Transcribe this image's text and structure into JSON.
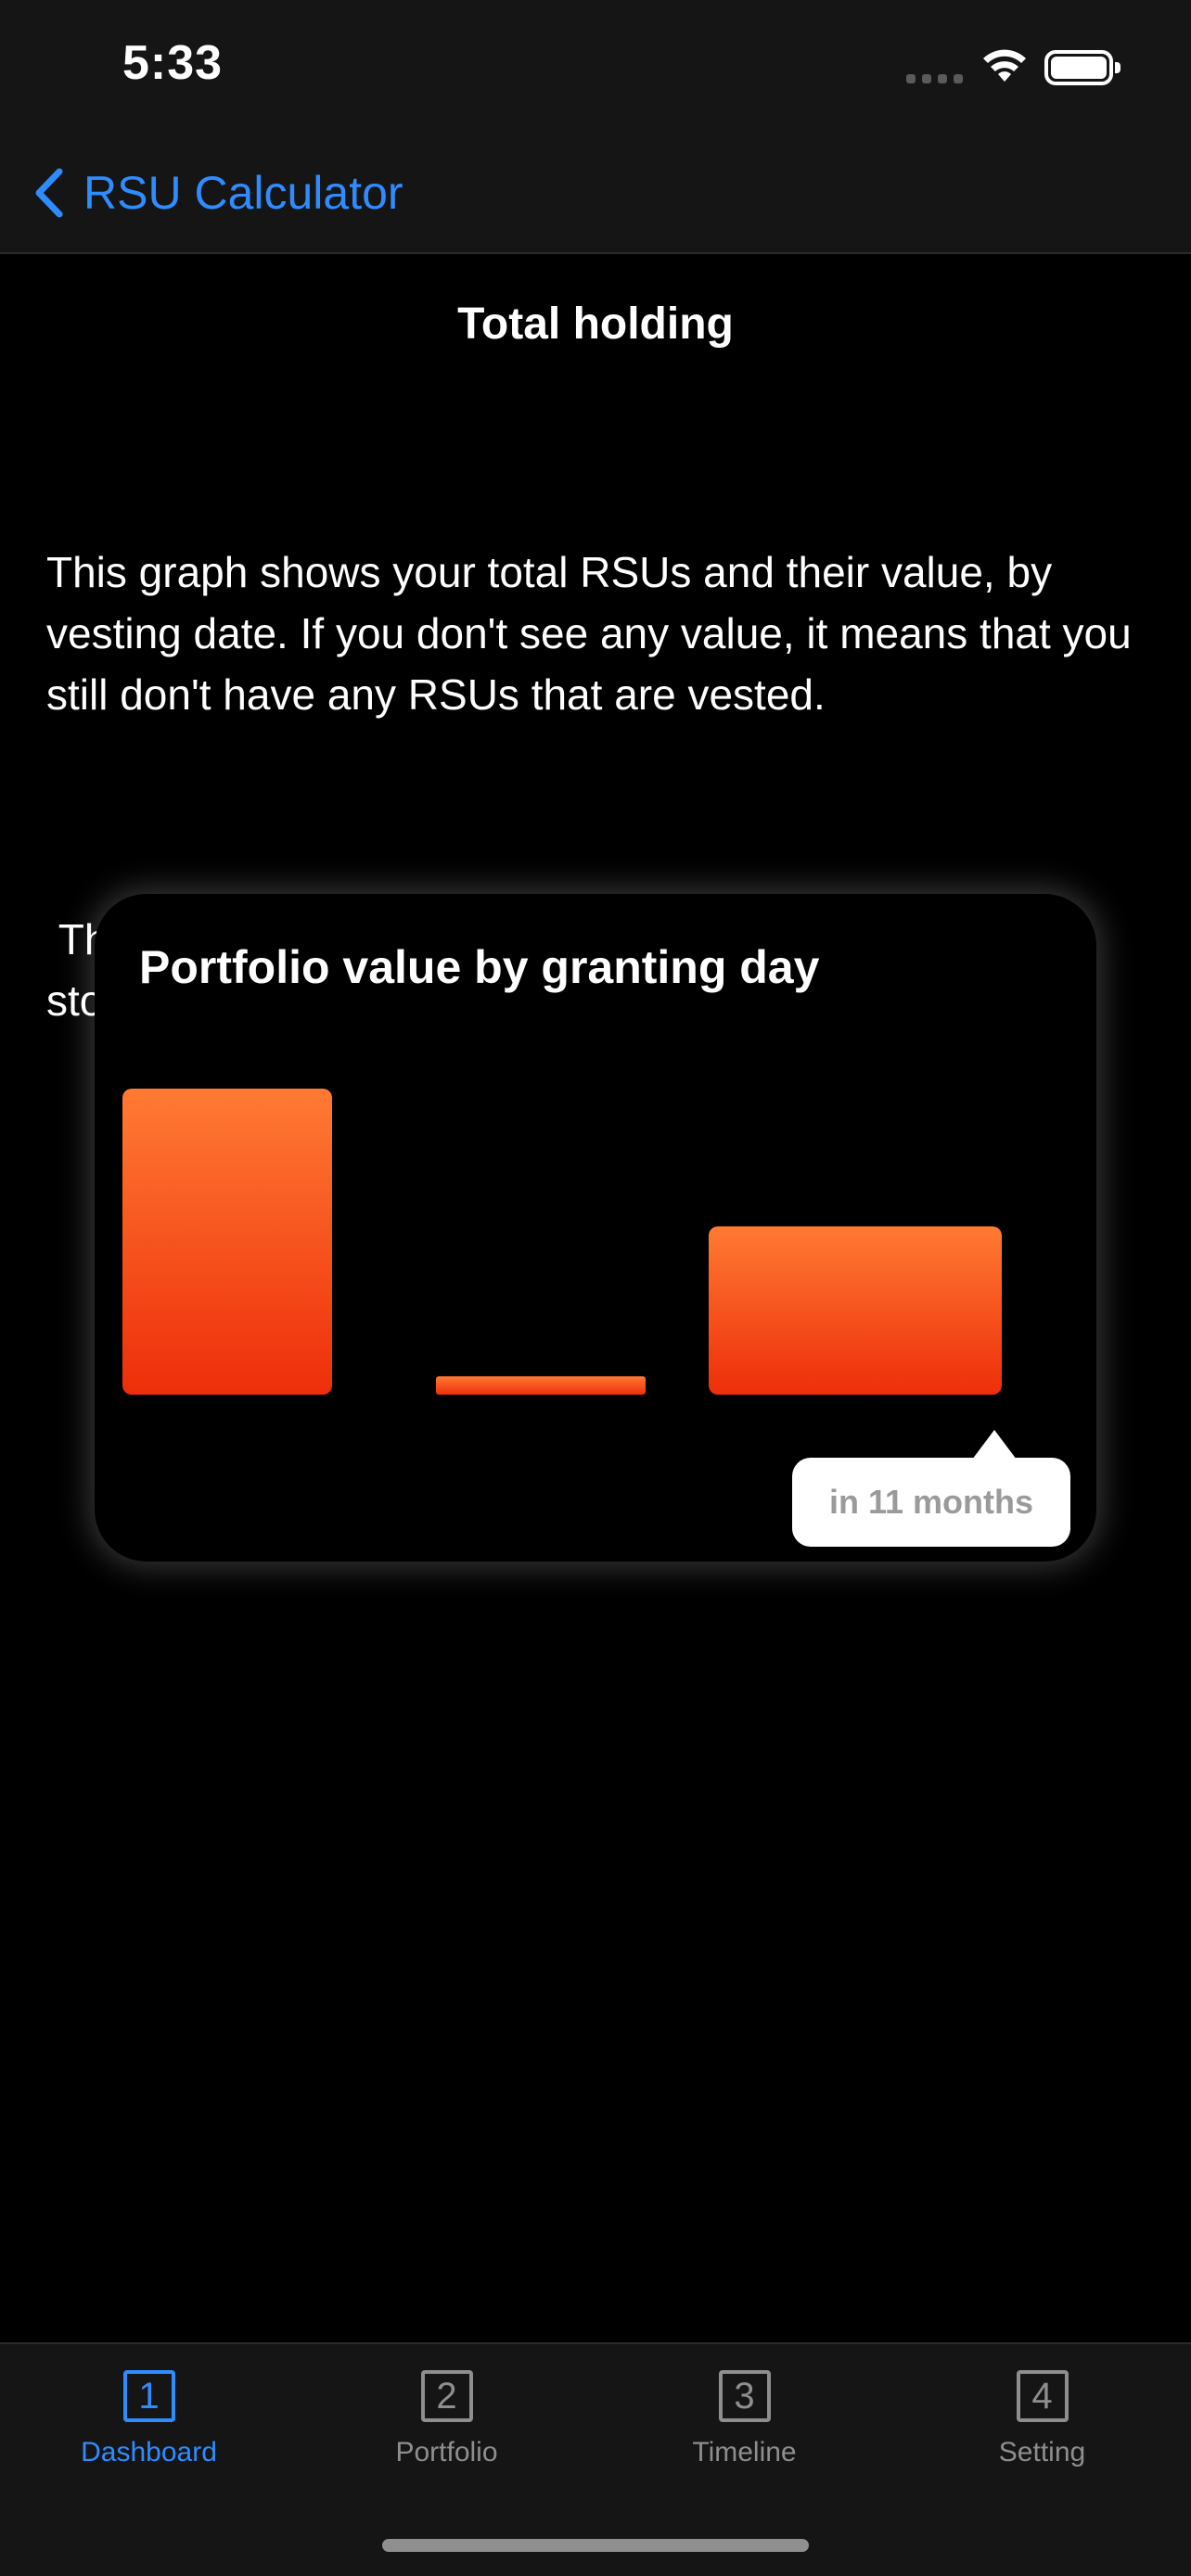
{
  "status_bar": {
    "time": "5:33",
    "icons": [
      "cellular-signal-icon",
      "wifi-icon",
      "battery-icon"
    ]
  },
  "nav": {
    "back_label": "RSU Calculator",
    "back_icon": "chevron-left-icon",
    "accent_color": "#2f8cff"
  },
  "page": {
    "title": "Total holding",
    "description": [
      "This graph shows your total RSUs and their value, by vesting date. If you don't see any value, it means that you still don't have any RSUs that are vested.",
      " The value of each data point is the number of vested stocks multiple the current stock value."
    ]
  },
  "chart_data": {
    "type": "bar",
    "title": "Portfolio value by granting day",
    "categories": [],
    "values": [
      100,
      6,
      55
    ],
    "gradient": [
      "#ff7a33",
      "#ee2e0a"
    ],
    "grid": false,
    "legend": "none",
    "tooltip": "in 11 months"
  },
  "tabs": [
    {
      "icon": "1",
      "icon_name": "number-1-square-icon",
      "label": "Dashboard",
      "active": true
    },
    {
      "icon": "2",
      "icon_name": "number-2-square-icon",
      "label": "Portfolio",
      "active": false
    },
    {
      "icon": "3",
      "icon_name": "number-3-square-icon",
      "label": "Timeline",
      "active": false
    },
    {
      "icon": "4",
      "icon_name": "number-4-square-icon",
      "label": "Setting",
      "active": false
    }
  ]
}
